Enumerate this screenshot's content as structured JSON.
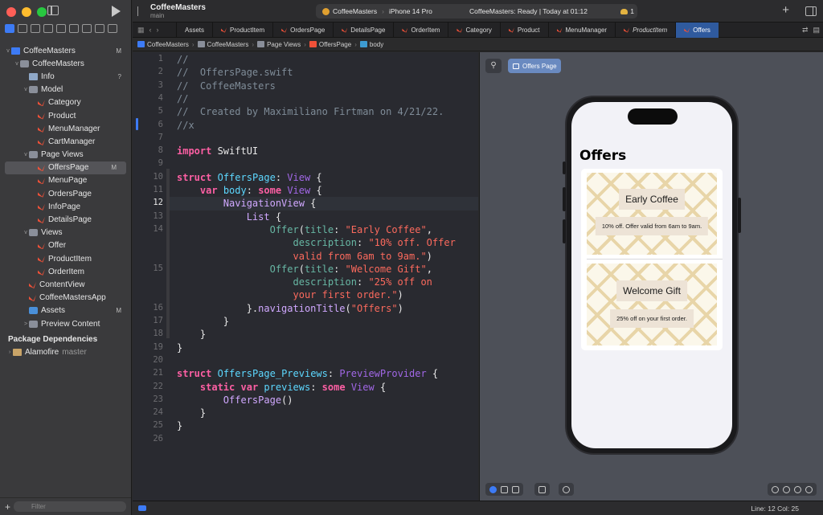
{
  "window": {
    "project_name": "CoffeeMasters",
    "branch": "main"
  },
  "scheme": {
    "app": "CoffeeMasters",
    "device": "iPhone 14 Pro",
    "status": "CoffeeMasters: Ready | Today at 01:12",
    "warnings": "1"
  },
  "sidebar": {
    "root": {
      "label": "CoffeeMasters",
      "badge": "M"
    },
    "items": [
      {
        "label": "CoffeeMasters",
        "kind": "folder",
        "depth": 1,
        "chev": "v",
        "badge": ""
      },
      {
        "label": "Info",
        "kind": "plist",
        "depth": 2,
        "chev": "",
        "badge": "?"
      },
      {
        "label": "Model",
        "kind": "folder",
        "depth": 2,
        "chev": "v",
        "badge": ""
      },
      {
        "label": "Category",
        "kind": "swift",
        "depth": 3,
        "chev": "",
        "badge": ""
      },
      {
        "label": "Product",
        "kind": "swift",
        "depth": 3,
        "chev": "",
        "badge": ""
      },
      {
        "label": "MenuManager",
        "kind": "swift",
        "depth": 3,
        "chev": "",
        "badge": ""
      },
      {
        "label": "CartManager",
        "kind": "swift",
        "depth": 3,
        "chev": "",
        "badge": ""
      },
      {
        "label": "Page Views",
        "kind": "folder",
        "depth": 2,
        "chev": "v",
        "badge": ""
      },
      {
        "label": "OffersPage",
        "kind": "swift",
        "depth": 3,
        "chev": "",
        "badge": "M",
        "selected": true
      },
      {
        "label": "MenuPage",
        "kind": "swift",
        "depth": 3,
        "chev": "",
        "badge": ""
      },
      {
        "label": "OrdersPage",
        "kind": "swift",
        "depth": 3,
        "chev": "",
        "badge": ""
      },
      {
        "label": "InfoPage",
        "kind": "swift",
        "depth": 3,
        "chev": "",
        "badge": ""
      },
      {
        "label": "DetailsPage",
        "kind": "swift",
        "depth": 3,
        "chev": "",
        "badge": ""
      },
      {
        "label": "Views",
        "kind": "folder",
        "depth": 2,
        "chev": "v",
        "badge": ""
      },
      {
        "label": "Offer",
        "kind": "swift",
        "depth": 3,
        "chev": "",
        "badge": ""
      },
      {
        "label": "ProductItem",
        "kind": "swift",
        "depth": 3,
        "chev": "",
        "badge": ""
      },
      {
        "label": "OrderItem",
        "kind": "swift",
        "depth": 3,
        "chev": "",
        "badge": ""
      },
      {
        "label": "ContentView",
        "kind": "swift",
        "depth": 2,
        "chev": "",
        "badge": ""
      },
      {
        "label": "CoffeeMastersApp",
        "kind": "swift",
        "depth": 2,
        "chev": "",
        "badge": ""
      },
      {
        "label": "Assets",
        "kind": "assets",
        "depth": 2,
        "chev": "",
        "badge": "M"
      },
      {
        "label": "Preview Content",
        "kind": "folder",
        "depth": 2,
        "chev": ">",
        "badge": ""
      }
    ],
    "package_header": "Package Dependencies",
    "package": {
      "label": "Alamofire",
      "version": "master"
    },
    "filter_placeholder": "Filter"
  },
  "tabs": [
    {
      "label": "Assets",
      "italic": false,
      "active": false,
      "swift": false
    },
    {
      "label": "ProductItem",
      "italic": false,
      "active": false,
      "swift": true
    },
    {
      "label": "OrdersPage",
      "italic": false,
      "active": false,
      "swift": true
    },
    {
      "label": "DetailsPage",
      "italic": false,
      "active": false,
      "swift": true
    },
    {
      "label": "OrderItem",
      "italic": false,
      "active": false,
      "swift": true
    },
    {
      "label": "Category",
      "italic": false,
      "active": false,
      "swift": true
    },
    {
      "label": "Product",
      "italic": false,
      "active": false,
      "swift": true
    },
    {
      "label": "MenuManager",
      "italic": false,
      "active": false,
      "swift": true
    },
    {
      "label": "ProductItem",
      "italic": true,
      "active": false,
      "swift": true
    },
    {
      "label": "Offers",
      "italic": false,
      "active": true,
      "swift": true
    }
  ],
  "breadcrumb": [
    "CoffeeMasters",
    "CoffeeMasters",
    "Page Views",
    "OffersPage",
    "body"
  ],
  "editor": {
    "current_line": 12,
    "lines": [
      {
        "n": "1",
        "t": [
          [
            "//",
            "com"
          ]
        ]
      },
      {
        "n": "2",
        "t": [
          [
            "//  OffersPage.swift",
            "com"
          ]
        ]
      },
      {
        "n": "3",
        "t": [
          [
            "//  CoffeeMasters",
            "com"
          ]
        ]
      },
      {
        "n": "4",
        "t": [
          [
            "//",
            "com"
          ]
        ]
      },
      {
        "n": "5",
        "t": [
          [
            "//  Created by Maximiliano Firtman on 4/21/22.",
            "com"
          ]
        ]
      },
      {
        "n": "6",
        "t": [
          [
            "//x",
            "com"
          ]
        ]
      },
      {
        "n": "7",
        "t": []
      },
      {
        "n": "8",
        "t": [
          [
            "import",
            "kw"
          ],
          [
            " SwiftUI",
            "plain"
          ]
        ]
      },
      {
        "n": "9",
        "t": []
      },
      {
        "n": "10",
        "t": [
          [
            "struct",
            "kw"
          ],
          [
            " ",
            "plain"
          ],
          [
            "OffersPage",
            "type"
          ],
          [
            ": ",
            "plain"
          ],
          [
            "View",
            "prop"
          ],
          [
            " {",
            "plain"
          ]
        ]
      },
      {
        "n": "11",
        "t": [
          [
            "    ",
            "plain"
          ],
          [
            "var",
            "kw"
          ],
          [
            " ",
            "plain"
          ],
          [
            "body",
            "type"
          ],
          [
            ": ",
            "plain"
          ],
          [
            "some",
            "kw"
          ],
          [
            " ",
            "plain"
          ],
          [
            "View",
            "prop"
          ],
          [
            " {",
            "plain"
          ]
        ]
      },
      {
        "n": "12",
        "t": [
          [
            "        ",
            "plain"
          ],
          [
            "NavigationView",
            "other"
          ],
          [
            " {",
            "plain"
          ]
        ]
      },
      {
        "n": "13",
        "t": [
          [
            "            ",
            "plain"
          ],
          [
            "List",
            "other"
          ],
          [
            " {",
            "plain"
          ]
        ]
      },
      {
        "n": "14",
        "t": [
          [
            "                ",
            "plain"
          ],
          [
            "Offer",
            "fn"
          ],
          [
            "(",
            "plain"
          ],
          [
            "title",
            "fn"
          ],
          [
            ": ",
            "plain"
          ],
          [
            "\"Early Coffee\"",
            "str"
          ],
          [
            ",",
            "plain"
          ]
        ]
      },
      {
        "n": "",
        "t": [
          [
            "                    ",
            "plain"
          ],
          [
            "description",
            "fn"
          ],
          [
            ": ",
            "plain"
          ],
          [
            "\"10% off. Offer",
            "str"
          ]
        ]
      },
      {
        "n": "",
        "t": [
          [
            "                    ",
            "plain"
          ],
          [
            "valid from 6am to 9am.\"",
            "str"
          ],
          [
            ")",
            "plain"
          ]
        ]
      },
      {
        "n": "15",
        "t": [
          [
            "                ",
            "plain"
          ],
          [
            "Offer",
            "fn"
          ],
          [
            "(",
            "plain"
          ],
          [
            "title",
            "fn"
          ],
          [
            ": ",
            "plain"
          ],
          [
            "\"Welcome Gift\"",
            "str"
          ],
          [
            ",",
            "plain"
          ]
        ]
      },
      {
        "n": "",
        "t": [
          [
            "                    ",
            "plain"
          ],
          [
            "description",
            "fn"
          ],
          [
            ": ",
            "plain"
          ],
          [
            "\"25% off on",
            "str"
          ]
        ]
      },
      {
        "n": "",
        "t": [
          [
            "                    ",
            "plain"
          ],
          [
            "your first order.\"",
            "str"
          ],
          [
            ")",
            "plain"
          ]
        ]
      },
      {
        "n": "16",
        "t": [
          [
            "            }.",
            "plain"
          ],
          [
            "navigationTitle",
            "other"
          ],
          [
            "(",
            "plain"
          ],
          [
            "\"Offers\"",
            "str"
          ],
          [
            ")",
            "plain"
          ]
        ]
      },
      {
        "n": "17",
        "t": [
          [
            "        }",
            "plain"
          ]
        ]
      },
      {
        "n": "18",
        "t": [
          [
            "    }",
            "plain"
          ]
        ]
      },
      {
        "n": "19",
        "t": [
          [
            "}",
            "plain"
          ]
        ]
      },
      {
        "n": "20",
        "t": []
      },
      {
        "n": "21",
        "t": [
          [
            "struct",
            "kw"
          ],
          [
            " ",
            "plain"
          ],
          [
            "OffersPage_Previews",
            "type"
          ],
          [
            ": ",
            "plain"
          ],
          [
            "PreviewProvider",
            "prop"
          ],
          [
            " {",
            "plain"
          ]
        ]
      },
      {
        "n": "22",
        "t": [
          [
            "    ",
            "plain"
          ],
          [
            "static",
            "kw"
          ],
          [
            " ",
            "plain"
          ],
          [
            "var",
            "kw"
          ],
          [
            " ",
            "plain"
          ],
          [
            "previews",
            "type"
          ],
          [
            ": ",
            "plain"
          ],
          [
            "some",
            "kw"
          ],
          [
            " ",
            "plain"
          ],
          [
            "View",
            "prop"
          ],
          [
            " {",
            "plain"
          ]
        ]
      },
      {
        "n": "23",
        "t": [
          [
            "        ",
            "plain"
          ],
          [
            "OffersPage",
            "other"
          ],
          [
            "()",
            "plain"
          ]
        ]
      },
      {
        "n": "24",
        "t": [
          [
            "    }",
            "plain"
          ]
        ]
      },
      {
        "n": "25",
        "t": [
          [
            "}",
            "plain"
          ]
        ]
      },
      {
        "n": "26",
        "t": []
      }
    ]
  },
  "preview": {
    "tab_label": "Offers Page",
    "nav_title": "Offers",
    "offers": [
      {
        "title": "Early Coffee",
        "description": "10% off. Offer valid from 6am to 9am."
      },
      {
        "title": "Welcome Gift",
        "description": "25% off on your first order."
      }
    ]
  },
  "status": {
    "position": "Line: 12  Col: 25"
  },
  "colors": {
    "accent": "#3d7bf5",
    "swift": "#f05138",
    "keyword": "#fc5fa3",
    "type": "#5dd8ff",
    "string": "#fc6a5d",
    "comment": "#7f8c98"
  }
}
